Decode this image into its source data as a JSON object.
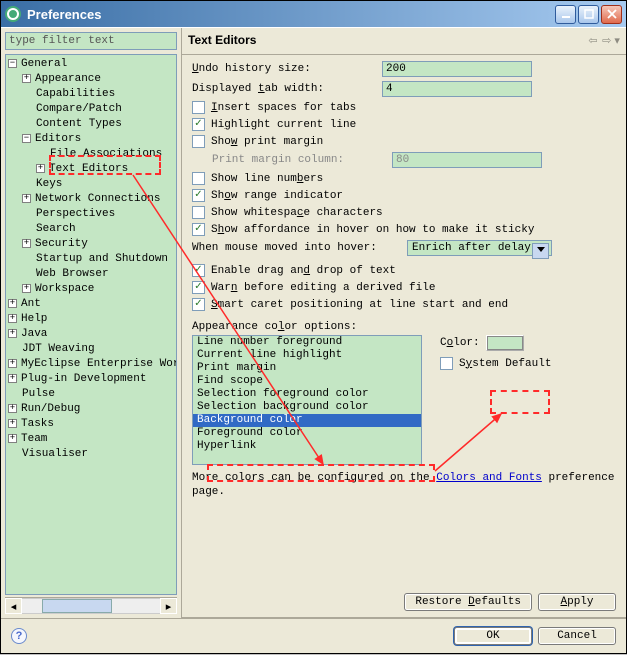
{
  "window": {
    "title": "Preferences"
  },
  "sidebar": {
    "filter_placeholder": "type filter text",
    "tree": {
      "general": "General",
      "appearance": "Appearance",
      "capabilities": "Capabilities",
      "compare_patch": "Compare/Patch",
      "content_types": "Content Types",
      "editors": "Editors",
      "file_assoc": "File Associations",
      "text_editors": "Text Editors",
      "keys": "Keys",
      "network": "Network Connections",
      "perspectives": "Perspectives",
      "search": "Search",
      "security": "Security",
      "startup": "Startup and Shutdown",
      "web_browser": "Web Browser",
      "workspace": "Workspace",
      "ant": "Ant",
      "help": "Help",
      "java": "Java",
      "jdt": "JDT Weaving",
      "myeclipse": "MyEclipse Enterprise Work",
      "plugin_dev": "Plug-in Development",
      "pulse": "Pulse",
      "run_debug": "Run/Debug",
      "tasks": "Tasks",
      "team": "Team",
      "visualiser": "Visualiser"
    }
  },
  "main": {
    "title": "Text Editors",
    "undo_label": "Undo history size:",
    "undo_value": "200",
    "tab_label": "Displayed tab width:",
    "tab_value": "4",
    "insert_spaces": "Insert spaces for tabs",
    "highlight_line": "Highlight current line",
    "show_print_margin": "Show print margin",
    "print_margin_col_label": "Print margin column:",
    "print_margin_col_value": "80",
    "show_line_numbers": "Show line numbers",
    "show_range": "Show range indicator",
    "show_whitespace": "Show whitespace characters",
    "show_affordance": "Show affordance in hover on how to make it sticky",
    "hover_label": "When mouse moved into hover:",
    "hover_value": "Enrich after delay",
    "enable_dnd": "Enable drag and drop of text",
    "warn_derived": "Warn before editing a derived file",
    "smart_caret": "Smart caret positioning at line start and end",
    "appearance_label": "Appearance color options:",
    "color_options": [
      "Line number foreground",
      "Current line highlight",
      "Print margin",
      "Find scope",
      "Selection foreground color",
      "Selection background color",
      "Background color",
      "Foreground color",
      "Hyperlink"
    ],
    "selected_color_index": 6,
    "color_label": "Color:",
    "system_default": "System Default",
    "more_colors_pre": "More colors can be configured on the ",
    "more_colors_link": "Colors and Fonts",
    "more_colors_post": " preference page.",
    "restore_defaults": "Restore Defaults",
    "apply": "Apply",
    "ok": "OK",
    "cancel": "Cancel"
  },
  "checks": {
    "insert_spaces": false,
    "highlight_line": true,
    "show_print_margin": false,
    "show_line_numbers": false,
    "show_range": true,
    "show_whitespace": false,
    "show_affordance": true,
    "enable_dnd": true,
    "warn_derived": true,
    "smart_caret": true,
    "system_default": false
  },
  "annotations": {
    "highlight_tree_item": "Text Editors",
    "highlight_list_item": "Background color",
    "highlight_color_swatch": true
  }
}
